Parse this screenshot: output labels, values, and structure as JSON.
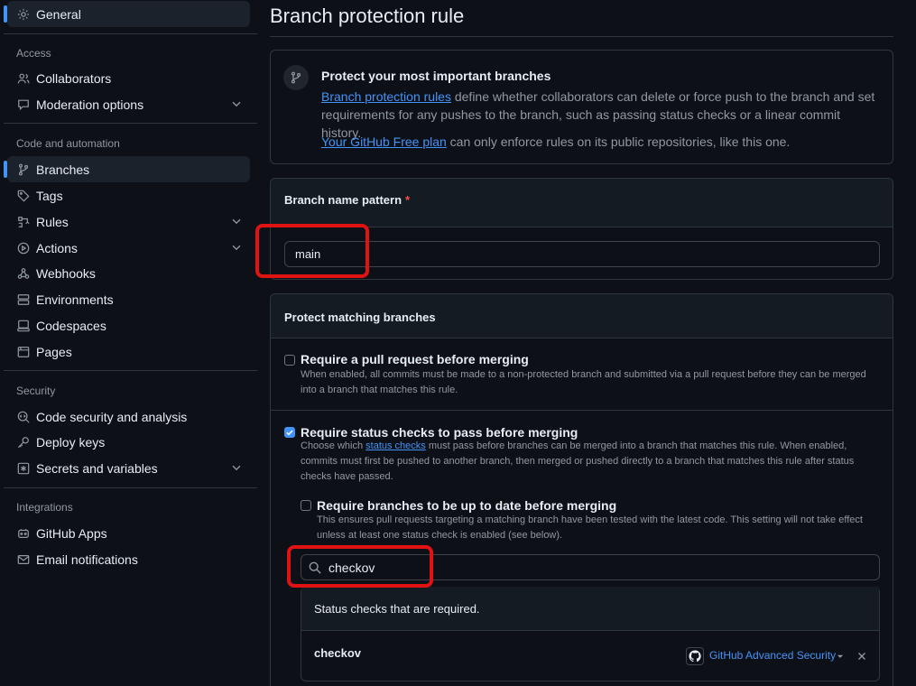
{
  "sidebar": {
    "general": "General",
    "access_label": "Access",
    "collaborators": "Collaborators",
    "moderation": "Moderation options",
    "code_automation_label": "Code and automation",
    "branches": "Branches",
    "tags": "Tags",
    "rules": "Rules",
    "actions": "Actions",
    "webhooks": "Webhooks",
    "environments": "Environments",
    "codespaces": "Codespaces",
    "pages": "Pages",
    "security_label": "Security",
    "code_security": "Code security and analysis",
    "deploy_keys": "Deploy keys",
    "secrets": "Secrets and variables",
    "integrations_label": "Integrations",
    "github_apps": "GitHub Apps",
    "email_notifications": "Email notifications"
  },
  "main": {
    "title": "Branch protection rule",
    "info": {
      "heading": "Protect your most important branches",
      "link_rules": "Branch protection rules",
      "body_rest": " define whether collaborators can delete or force push to the branch and set requirements for any pushes to the branch, such as passing status checks or a linear commit history.",
      "link_plan": "Your GitHub Free plan",
      "plan_rest": " can only enforce rules on its public repositories, like this one."
    },
    "pattern": {
      "label": "Branch name pattern",
      "required_mark": "*",
      "value": "main"
    },
    "protect": {
      "header": "Protect matching branches",
      "pr": {
        "title": "Require a pull request before merging",
        "desc": "When enabled, all commits must be made to a non-protected branch and submitted via a pull request before they can be merged into a branch that matches this rule.",
        "checked": false
      },
      "status": {
        "title": "Require status checks to pass before merging",
        "desc_pre": "Choose which ",
        "desc_link": "status checks",
        "desc_post": " must pass before branches can be merged into a branch that matches this rule. When enabled, commits must first be pushed to another branch, then merged or pushed directly to a branch that matches this rule after status checks have passed.",
        "checked": true
      },
      "up_to_date": {
        "title": "Require branches to be up to date before merging",
        "desc": "This ensures pull requests targeting a matching branch have been tested with the latest code. This setting will not take effect unless at least one status check is enabled (see below).",
        "checked": false
      },
      "search_value": "checkov",
      "required_header": "Status checks that are required.",
      "check_name": "checkov",
      "app_name": "GitHub Advanced Security"
    }
  },
  "colors": {
    "accent": "#4493f8",
    "highlight": "#e11212",
    "background": "#0d1117"
  }
}
